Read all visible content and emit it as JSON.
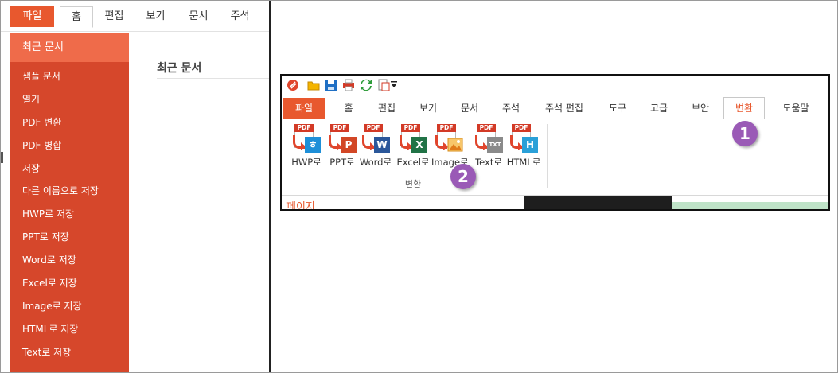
{
  "left_panel": {
    "tabs": [
      "파일",
      "홈",
      "편집",
      "보기",
      "문서",
      "주석"
    ],
    "sidebar_items": [
      "최근 문서",
      "샘플 문서",
      "열기",
      "PDF 변환",
      "PDF 병합",
      "저장",
      "다른 이름으로 저장",
      "HWP로 저장",
      "PPT로 저장",
      "Word로 저장",
      "Excel로 저장",
      "Image로 저장",
      "HTML로 저장",
      "Text로 저장"
    ],
    "content_title": "최근 문서"
  },
  "ribbon": {
    "tabs": [
      "파일",
      "홈",
      "편집",
      "보기",
      "문서",
      "주석",
      "주석 편집",
      "도구",
      "고급",
      "보안",
      "변환",
      "도움말"
    ],
    "active_tab": "변환",
    "convert_buttons": [
      {
        "label": "HWP로",
        "icon": "hwp-icon",
        "badge_color": "#1e8fd8",
        "badge_text": "ㅎ"
      },
      {
        "label": "PPT로",
        "icon": "ppt-icon",
        "badge_color": "#d24726",
        "badge_text": "P"
      },
      {
        "label": "Word로",
        "icon": "word-icon",
        "badge_color": "#2b579a",
        "badge_text": "W"
      },
      {
        "label": "Excel로",
        "icon": "excel-icon",
        "badge_color": "#217346",
        "badge_text": "X"
      },
      {
        "label": "Image로",
        "icon": "image-icon",
        "badge_color": "#f0a030",
        "badge_text": ""
      },
      {
        "label": "Text로",
        "icon": "text-icon",
        "badge_color": "#8a8a8a",
        "badge_text": "TXT"
      },
      {
        "label": "HTML로",
        "icon": "html-icon",
        "badge_color": "#2aa0d8",
        "badge_text": "H"
      }
    ],
    "pdf_tag": "PDF",
    "group_label": "변환",
    "page_panel_label": "페이지"
  },
  "callouts": [
    "1",
    "2"
  ],
  "colors": {
    "accent": "#e8582e",
    "sidebar": "#d6472b",
    "sidebar_selected": "#ef6b4a",
    "callout": "#9a5ab6"
  }
}
